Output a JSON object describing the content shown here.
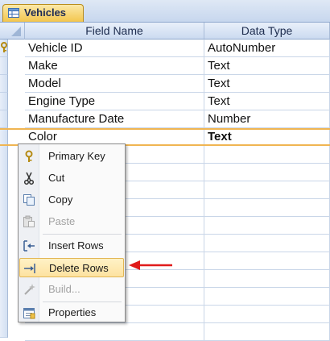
{
  "tab": {
    "label": "Vehicles",
    "icon": "table-icon"
  },
  "columns": [
    "Field Name",
    "Data Type"
  ],
  "rows": [
    {
      "field": "Vehicle ID",
      "type": "AutoNumber",
      "primary_key": true
    },
    {
      "field": "Make",
      "type": "Text"
    },
    {
      "field": "Model",
      "type": "Text"
    },
    {
      "field": "Engine Type",
      "type": "Text"
    },
    {
      "field": "Manufacture Date",
      "type": "Number"
    },
    {
      "field": "Color",
      "type": "Text",
      "selected": true
    }
  ],
  "context_menu": {
    "items": [
      {
        "label": "Primary Key",
        "icon": "key-icon",
        "enabled": true
      },
      {
        "label": "Cut",
        "icon": "scissors-icon",
        "enabled": true
      },
      {
        "label": "Copy",
        "icon": "copy-icon",
        "enabled": true
      },
      {
        "label": "Paste",
        "icon": "paste-icon",
        "enabled": false
      },
      {
        "label": "Insert Rows",
        "icon": "insert-rows-icon",
        "enabled": true
      },
      {
        "label": "Delete Rows",
        "icon": "delete-rows-icon",
        "enabled": true,
        "highlighted": true
      },
      {
        "label": "Build...",
        "icon": "build-wand-icon",
        "enabled": false
      },
      {
        "label": "Properties",
        "icon": "properties-icon",
        "enabled": true
      }
    ]
  },
  "annotation": {
    "icon": "red-arrow-icon",
    "color": "#e01b1b"
  },
  "colors": {
    "selection_border": "#f0b552",
    "menu_highlight": "#fde2a0",
    "tab": "#f3c64e"
  }
}
